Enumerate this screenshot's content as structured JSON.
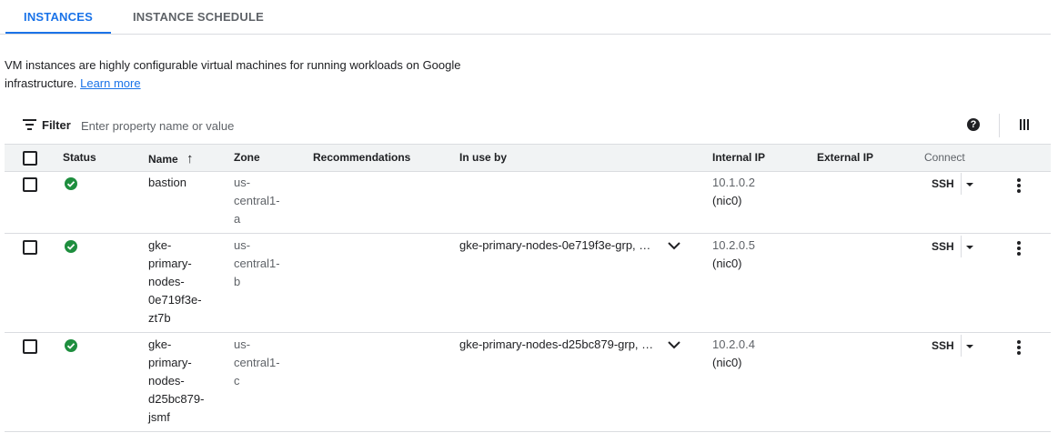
{
  "tabs": [
    {
      "label": "INSTANCES",
      "active": true
    },
    {
      "label": "INSTANCE SCHEDULE",
      "active": false
    }
  ],
  "description": {
    "text": "VM instances are highly configurable virtual machines for running workloads on Google infrastructure.",
    "link": "Learn more"
  },
  "filter": {
    "label": "Filter",
    "placeholder": "Enter property name or value",
    "icon": "filter-icon"
  },
  "toolbar": {
    "help_icon": "help-icon",
    "help_glyph": "?",
    "columns_icon": "column-display-icon"
  },
  "table": {
    "headers": {
      "status": "Status",
      "name": "Name",
      "zone": "Zone",
      "recommendations": "Recommendations",
      "in_use_by": "In use by",
      "internal_ip": "Internal IP",
      "external_ip": "External IP",
      "connect": "Connect"
    },
    "sort_arrow": "↑",
    "rows": [
      {
        "status": "running",
        "name_lines": [
          "bastion"
        ],
        "zone_lines": [
          "us-",
          "central1-",
          "a"
        ],
        "in_use_by": "",
        "internal_ip": "10.1.0.2",
        "nic": "(nic0)",
        "connect": "SSH"
      },
      {
        "status": "running",
        "name_lines": [
          "gke-",
          "primary-",
          "nodes-",
          "0e719f3e-",
          "zt7b"
        ],
        "zone_lines": [
          "us-",
          "central1-",
          "b"
        ],
        "in_use_by": "gke-primary-nodes-0e719f3e-grp, …",
        "internal_ip": "10.2.0.5",
        "nic": "(nic0)",
        "connect": "SSH"
      },
      {
        "status": "running",
        "name_lines": [
          "gke-",
          "primary-",
          "nodes-",
          "d25bc879-",
          "jsmf"
        ],
        "zone_lines": [
          "us-",
          "central1-",
          "c"
        ],
        "in_use_by": "gke-primary-nodes-d25bc879-grp, …",
        "internal_ip": "10.2.0.4",
        "nic": "(nic0)",
        "connect": "SSH"
      }
    ]
  },
  "colors": {
    "accent": "#1a73e8",
    "status_ok": "#1e8e3e",
    "header_bg": "#f1f3f4"
  }
}
